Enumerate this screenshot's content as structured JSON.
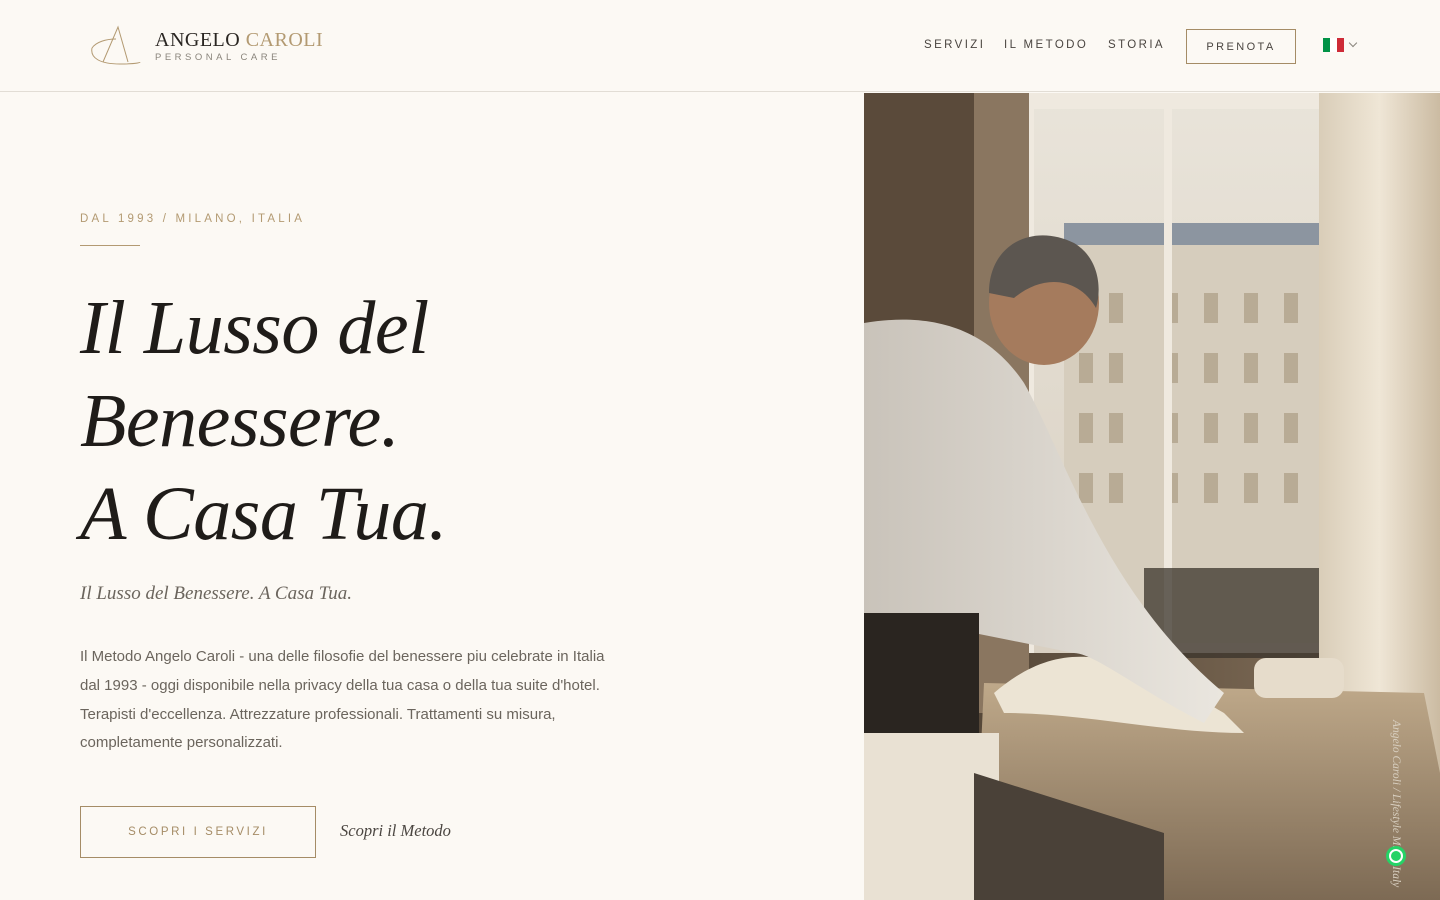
{
  "brand": {
    "name_first": "ANGELO",
    "name_last": "CAROLI",
    "tagline": "PERSONAL CARE",
    "logo_icon": "monogram-a-icon",
    "accent_color": "#b39a72"
  },
  "nav": {
    "items": [
      "SERVIZI",
      "IL METODO",
      "STORIA"
    ],
    "cta_label": "PRENOTA",
    "language_icon": "italian-flag-icon"
  },
  "hero": {
    "eyebrow": "DAL 1993 / MILANO, ITALIA",
    "headline_lines": [
      "Il Lusso del",
      "Benessere.",
      "A Casa Tua."
    ],
    "subhead": "Il Lusso del Benessere. A Casa Tua.",
    "body": "Il Metodo Angelo Caroli - una delle filosofie del benessere piu celebrate in Italia dal 1993 - oggi disponibile nella privacy della tua casa o della tua suite d'hotel. Terapisti d'eccellenza. Attrezzature professionali. Trattamenti su misura, completamente personalizzati.",
    "primary_cta": "SCOPRI I SERVIZI",
    "secondary_cta": "Scopri il Metodo"
  },
  "image": {
    "caption": "Angelo Caroli / Lifestyle Milan Italy",
    "whatsapp_icon": "whatsapp-icon"
  }
}
